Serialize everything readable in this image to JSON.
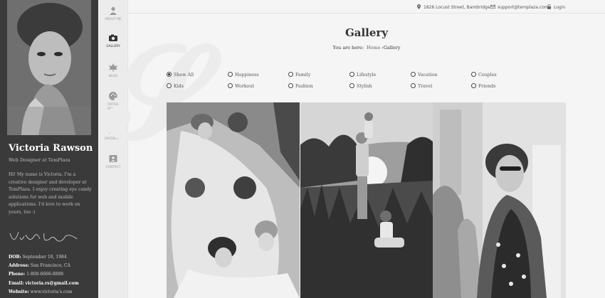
{
  "profile": {
    "name": "Victoria Rawson",
    "role": "Web Designer at TemPlaza",
    "bio": "Hi! My name is Victoria. I'm a creative designer and developer at TemPlaza. I enjoy creating eye candy solutions for web and mobile applications. I'd love to work on yours, too :)",
    "signature": "Victoria Rawson",
    "facts": [
      {
        "key": "DOB:",
        "value": "September 18, 1984"
      },
      {
        "key": "Address:",
        "value": "San Francisco, CA"
      },
      {
        "key": "Phone:",
        "value": "1-800-6666-8888"
      },
      {
        "key": "Email:",
        "value": "victoria.rs@gmail.com"
      },
      {
        "key": "Website:",
        "value": "www.victoria's.com"
      }
    ]
  },
  "nav": {
    "items": [
      {
        "label": "ABOUT ME",
        "icon": "user-icon"
      },
      {
        "label": "GALLERY",
        "icon": "camera-icon",
        "active": true
      },
      {
        "label": "BLOG",
        "icon": "leaf-icon"
      },
      {
        "label": "OFFICE HOURS",
        "icon": "palette-icon"
      },
      {
        "label": "FACEBOOK",
        "icon": "book-icon"
      },
      {
        "label": "CONTACT",
        "icon": "contact-icon"
      }
    ]
  },
  "topbar": {
    "address": "1826 Locust Street, Bambridge",
    "email": "support@templaza.com",
    "login": "Login"
  },
  "page": {
    "title": "Gallery",
    "breadcrumb_prefix": "You are here:",
    "breadcrumb_home": "Home",
    "breadcrumb_sep": "›",
    "breadcrumb_current": "Gallery"
  },
  "filters": [
    {
      "label": "Show All",
      "checked": true
    },
    {
      "label": "Happiness"
    },
    {
      "label": "Family"
    },
    {
      "label": "Lifestyle"
    },
    {
      "label": "Vacation"
    },
    {
      "label": "Couples"
    },
    {
      "label": "Kids"
    },
    {
      "label": "Workout"
    },
    {
      "label": "Fashion"
    },
    {
      "label": "Stylish"
    },
    {
      "label": "Travel"
    },
    {
      "label": "Friends"
    }
  ],
  "colors": {
    "sidebar_bg": "#3a3a3a",
    "nav_bg": "#ececec",
    "page_bg": "#f5f5f5",
    "text": "#333333"
  }
}
